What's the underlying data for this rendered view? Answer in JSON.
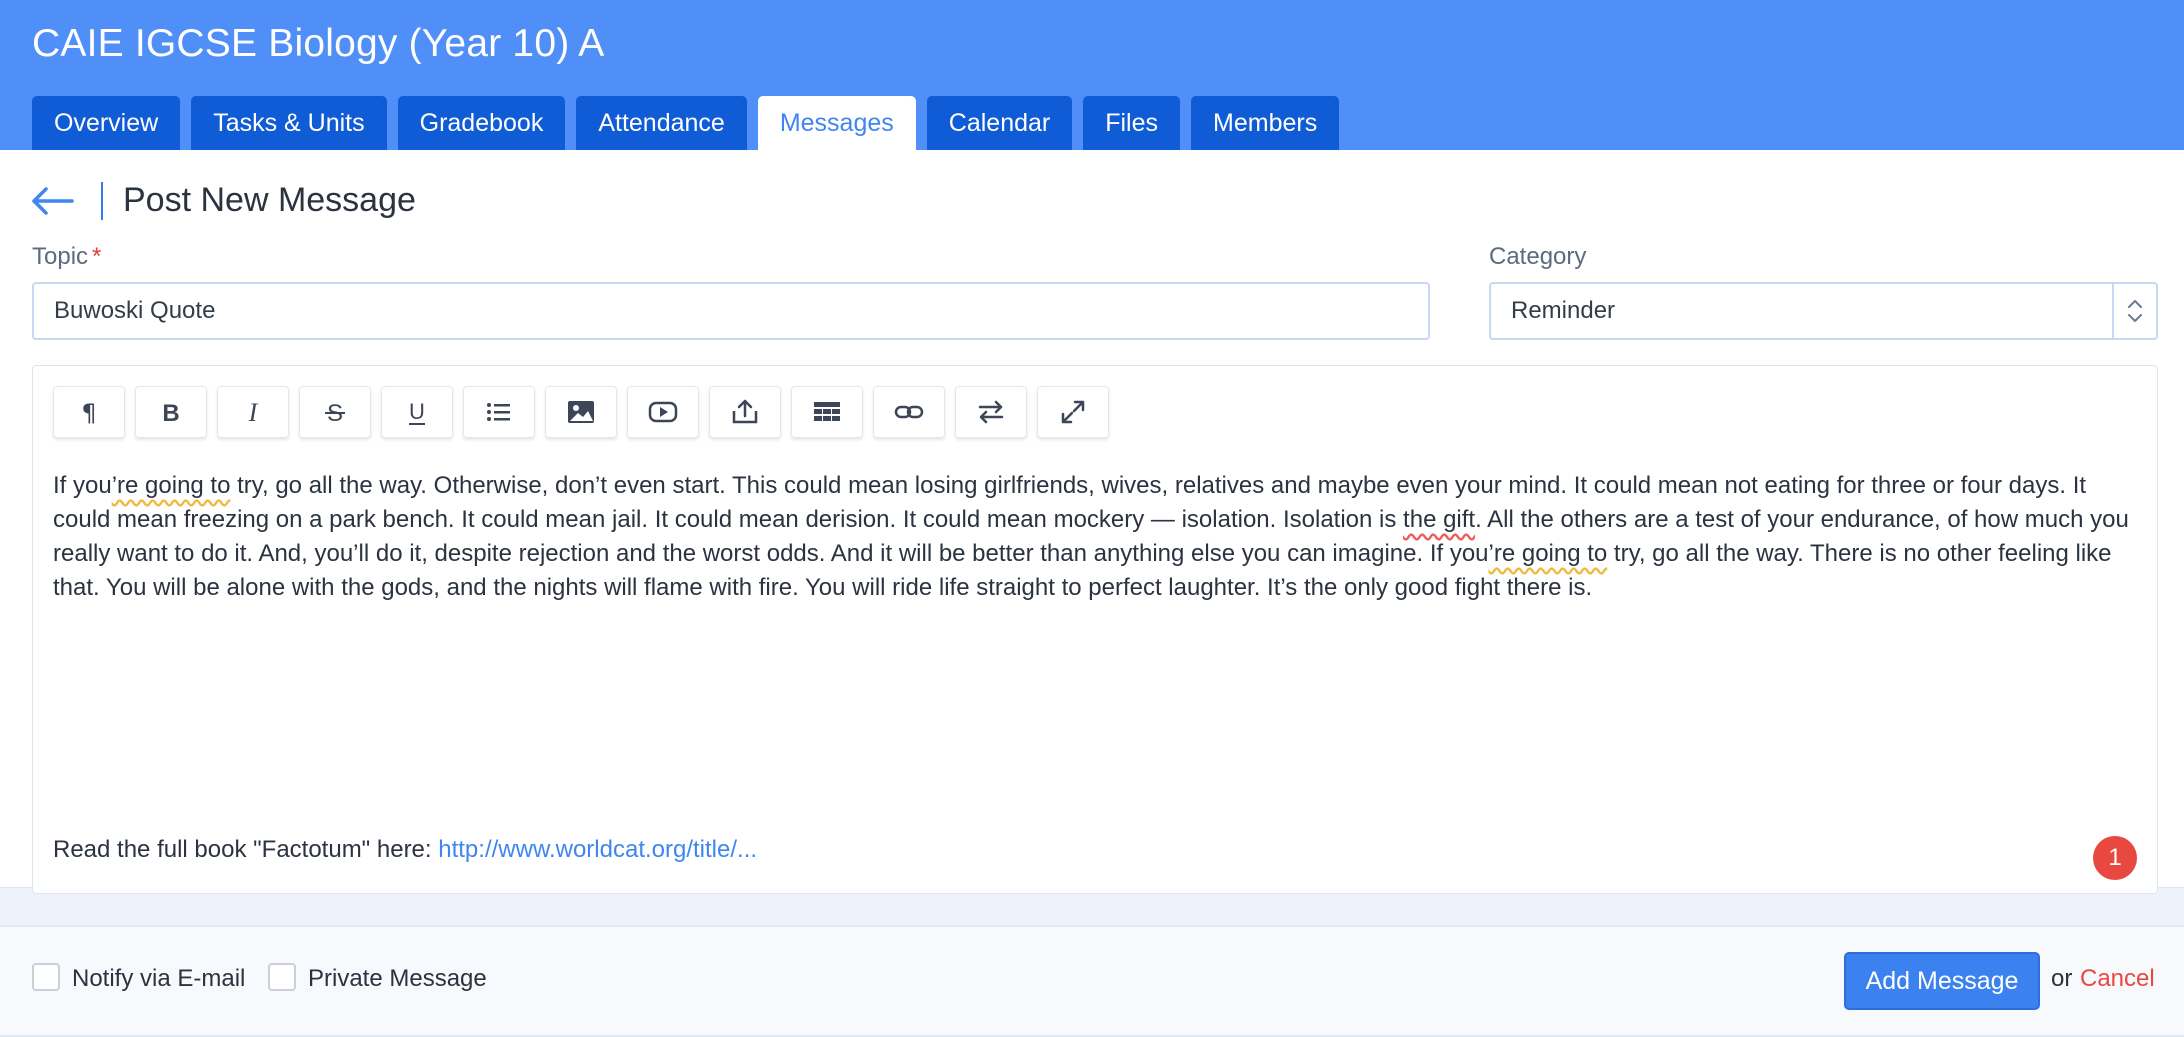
{
  "header": {
    "course_title": "CAIE IGCSE Biology (Year 10) A",
    "tabs": [
      {
        "label": "Overview"
      },
      {
        "label": "Tasks & Units"
      },
      {
        "label": "Gradebook"
      },
      {
        "label": "Attendance"
      },
      {
        "label": "Messages",
        "active": true
      },
      {
        "label": "Calendar"
      },
      {
        "label": "Files"
      },
      {
        "label": "Members"
      }
    ]
  },
  "form": {
    "page_title": "Post New Message",
    "topic_label": "Topic",
    "required_mark": "*",
    "topic_value": "Buwoski Quote",
    "category_label": "Category",
    "category_value": "Reminder"
  },
  "editor": {
    "toolbar": [
      "paragraph-icon",
      "bold-icon",
      "italic-icon",
      "strikethrough-icon",
      "underline-icon",
      "list-icon",
      "image-icon",
      "video-icon",
      "upload-icon",
      "table-icon",
      "link-icon",
      "swap-icon",
      "fullscreen-icon"
    ],
    "body": {
      "p1": "If you",
      "p2": "’re going to",
      "p3": " try, go all the way. Otherwise, don’t even start. This could mean losing girlfriends, wives, relatives and maybe even your mind. It could mean not eating for three or four days. It could mean freezing on a park bench. It could mean jail. It could mean derision. It could mean mockery — isolation. Isolation is ",
      "p4": "the gift",
      "p5": ". All the others are a test of your endurance, of how much you really want to do it. And, you’ll do it, despite rejection and the worst odds. And it will be better than anything else you can imagine. If you",
      "p6": "’re going to",
      "p7": " try, go all the way. There is no other feeling like that. You will be alone with the gods, and the nights will flame with fire. You will ride life straight to perfect laughter. It’s the only good fight there is."
    },
    "read_more_prefix": "Read the full book \"Factotum\" here: ",
    "read_more_link": "http://www.worldcat.org/title/...",
    "badge_count": "1"
  },
  "footer": {
    "notify_label": "Notify via E-mail",
    "private_label": "Private Message",
    "add_button": "Add Message",
    "or_text": "or",
    "cancel_label": "Cancel"
  },
  "colors": {
    "header_bg": "#4f8ff7",
    "tab_bg": "#0f5cd6",
    "accent": "#3b82f0",
    "danger": "#e8483f"
  }
}
